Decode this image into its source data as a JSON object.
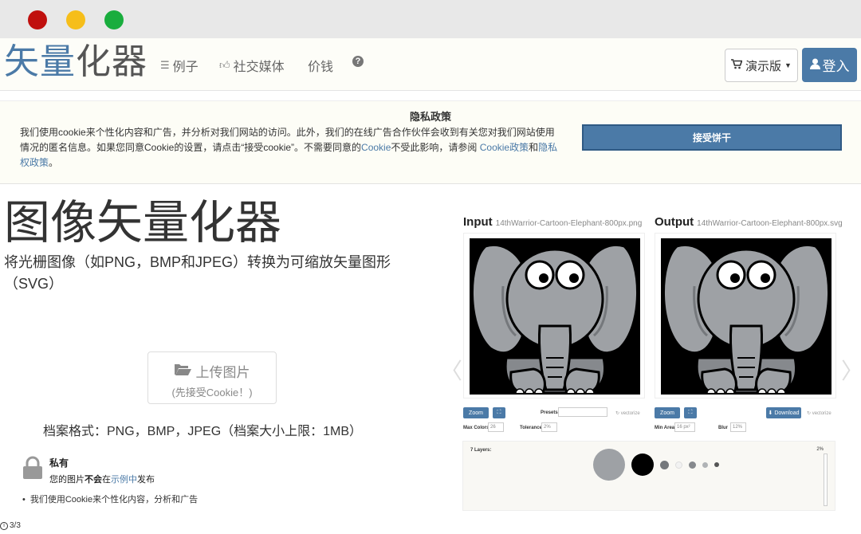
{
  "brand": {
    "highlight": "矢量",
    "rest": "化器"
  },
  "nav": {
    "examples": "例子",
    "social": "社交媒体",
    "pricing": "价钱",
    "demo": "演示版",
    "login": "登入"
  },
  "privacy": {
    "title": "隐私政策",
    "text_1": "我们使用cookie来个性化内容和广告，并分析对我们网站的访问。此外，我们的在线广告合作伙伴会收到有关您对我们网站使用情况的匿名信息。如果您同意Cookie的设置，请点击“接受cookie”。不需要同意的",
    "cookie_link": "Cookie",
    "text_2": "不受此影响，请参阅 ",
    "cookie_policy_link": "Cookie政策",
    "and": "和",
    "privacy_policy_link": "隐私权政策",
    "period": "。",
    "accept": "接受饼干"
  },
  "hero": {
    "title": "图像矢量化器",
    "subtitle": "将光栅图像（如PNG，BMP和JPEG）转换为可缩放矢量图形（SVG）",
    "upload_label": "上传图片",
    "upload_note": "(先接受Cookie！)",
    "formats": "档案格式：PNG，BMP，JPEG（档案大小上限：1MB）"
  },
  "private": {
    "title": "私有",
    "desc_1": "您的图片",
    "desc_bold": "不会",
    "desc_2": "在",
    "desc_link": "示例中",
    "desc_3": "发布",
    "bullet": "我们使用Cookie来个性化内容，分析和广告"
  },
  "pager": "3/3",
  "demo": {
    "input_label": "Input",
    "input_file": "14thWarrior-Cartoon-Elephant-800px.png",
    "output_label": "Output",
    "output_file": "14thWarrior-Cartoon-Elephant-800px.svg",
    "zoom": "Zoom",
    "download": "Download",
    "vectorize": "vectorize",
    "presets": "Presets",
    "max_colors": "Max Colors",
    "max_colors_val": "26",
    "tolerance": "Tolerance",
    "tolerance_val": "2%",
    "min_area": "Min Area",
    "min_area_val": "16 px²",
    "blur": "Blur",
    "blur_val": "12%",
    "layers": "7 Layers:",
    "layers_pct": "2%",
    "layer_colors": [
      "#9ea1a5",
      "#000000",
      "#75787c",
      "#f2f2f2",
      "#86898d",
      "#b0b3b6",
      "#555555"
    ]
  },
  "colors": {
    "accent": "#4b7aa7"
  }
}
